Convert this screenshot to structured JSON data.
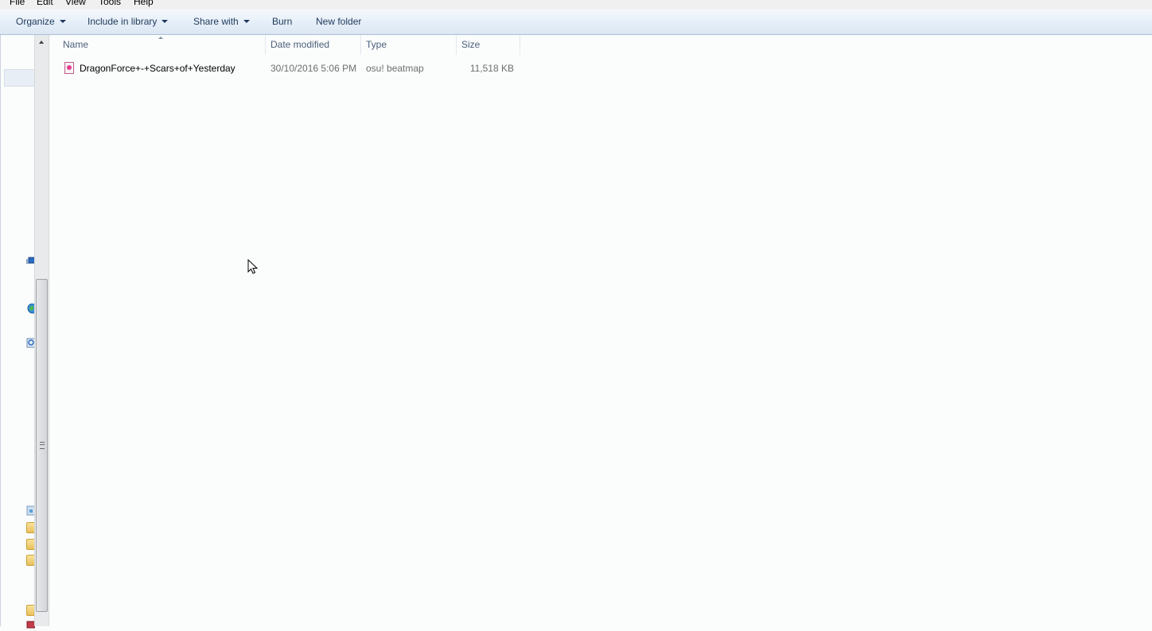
{
  "menubar": {
    "items": [
      "File",
      "Edit",
      "View",
      "Tools",
      "Help"
    ]
  },
  "toolbar": {
    "organize": "Organize",
    "include_in_library": "Include in library",
    "share_with": "Share with",
    "burn": "Burn",
    "new_folder": "New folder"
  },
  "columns": {
    "name": "Name",
    "date_modified": "Date modified",
    "type": "Type",
    "size": "Size"
  },
  "files": [
    {
      "name": "DragonForce+-+Scars+of+Yesterday",
      "date_modified": "30/10/2016 5:06 PM",
      "type": "osu! beatmap",
      "size": "11,518 KB"
    }
  ],
  "icons": {
    "file": "osu-beatmap-icon",
    "sort": "sort-ascending-icon"
  },
  "colors": {
    "accent": "#1e395b",
    "file_icon": "#e83e8c"
  }
}
